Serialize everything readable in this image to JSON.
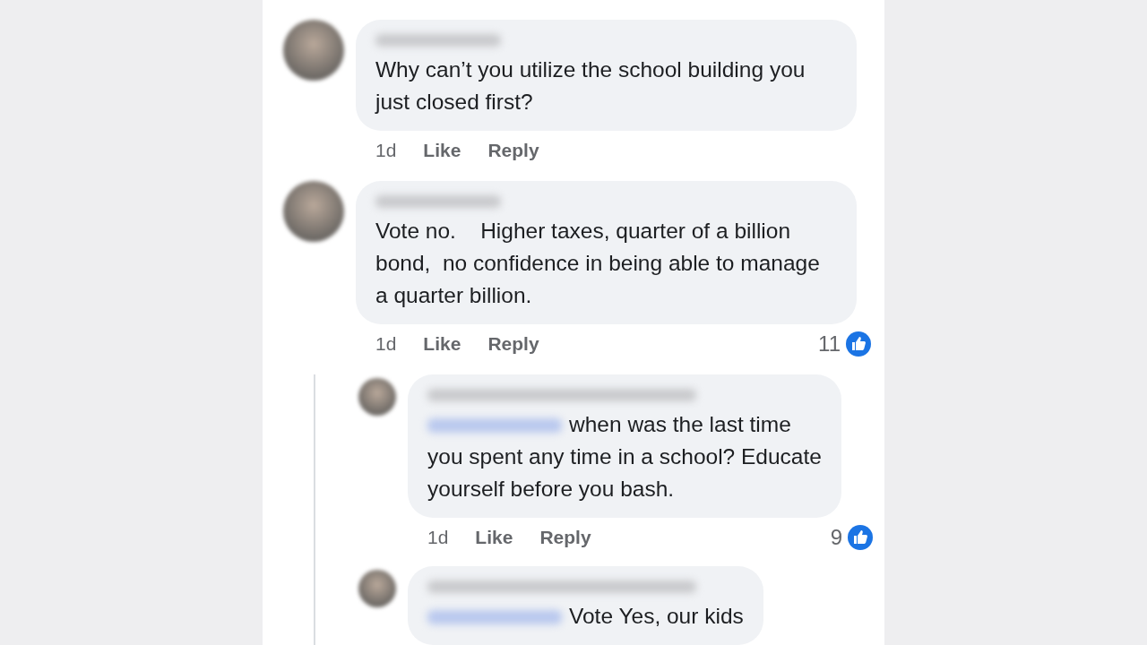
{
  "comments": [
    {
      "text": "Why can’t you utilize the school building you just closed first?",
      "time": "1d",
      "like": "Like",
      "reply": "Reply"
    },
    {
      "text": "Vote no.    Higher taxes, quarter of a billion bond,  no confidence in being able to manage a quarter billion.",
      "time": "1d",
      "like": "Like",
      "reply": "Reply",
      "reactions": "11",
      "replies": [
        {
          "mention_blurred": true,
          "text": "when was the last time you spent any time in a school? Educate yourself before you bash.",
          "time": "1d",
          "like": "Like",
          "reply": "Reply",
          "reactions": "9"
        },
        {
          "mention_blurred": true,
          "text": "Vote Yes, our kids"
        }
      ]
    }
  ]
}
